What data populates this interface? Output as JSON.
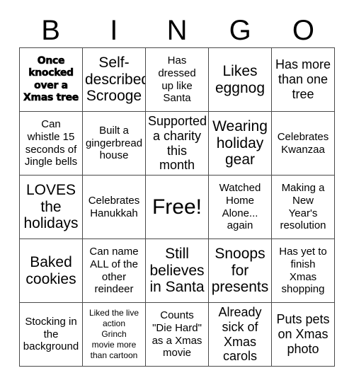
{
  "card": {
    "header_letters": [
      "B",
      "I",
      "N",
      "G",
      "O"
    ],
    "rows": [
      [
        {
          "text": "Once knocked over a Xmas tree",
          "style": "display"
        },
        {
          "text": "Self-\ndescribed\nScrooge",
          "style": "xl"
        },
        {
          "text": "Has\ndressed\nup like\nSanta",
          "style": "md"
        },
        {
          "text": "Likes\neggnog",
          "style": "xl"
        },
        {
          "text": "Has more\nthan one\ntree",
          "style": "lg"
        }
      ],
      [
        {
          "text": "Can\nwhistle 15\nseconds of\nJingle bells",
          "style": "md"
        },
        {
          "text": "Built a\ngingerbread\nhouse",
          "style": "md"
        },
        {
          "text": "Supported\na charity\nthis month",
          "style": "lg"
        },
        {
          "text": "Wearing\nholiday\ngear",
          "style": "xl"
        },
        {
          "text": "Celebrates\nKwanzaa",
          "style": "md"
        }
      ],
      [
        {
          "text": "LOVES\nthe\nholidays",
          "style": "xl"
        },
        {
          "text": "Celebrates\nHanukkah",
          "style": "md"
        },
        {
          "text": "Free!",
          "style": "xxl"
        },
        {
          "text": "Watched\nHome\nAlone...\nagain",
          "style": "md"
        },
        {
          "text": "Making a\nNew\nYear's\nresolution",
          "style": "md"
        }
      ],
      [
        {
          "text": "Baked\ncookies",
          "style": "xl"
        },
        {
          "text": "Can name\nALL of the\nother\nreindeer",
          "style": "md"
        },
        {
          "text": "Still\nbelieves\nin Santa",
          "style": "xl"
        },
        {
          "text": "Snoops\nfor\npresents",
          "style": "xl"
        },
        {
          "text": "Has yet to\nfinish\nXmas\nshopping",
          "style": "md"
        }
      ],
      [
        {
          "text": "Stocking in\nthe\nbackground",
          "style": "md"
        },
        {
          "text": "Liked the live\naction\nGrinch\nmovie more\nthan cartoon",
          "style": "xs"
        },
        {
          "text": "Counts\n\"Die Hard\"\nas a Xmas\nmovie",
          "style": "md"
        },
        {
          "text": "Already\nsick of\nXmas\ncarols",
          "style": "lg"
        },
        {
          "text": "Puts pets\non Xmas\nphoto",
          "style": "lg"
        }
      ]
    ]
  },
  "colors": {
    "border": "#4a4a4a",
    "text": "#000000",
    "background": "#ffffff"
  }
}
